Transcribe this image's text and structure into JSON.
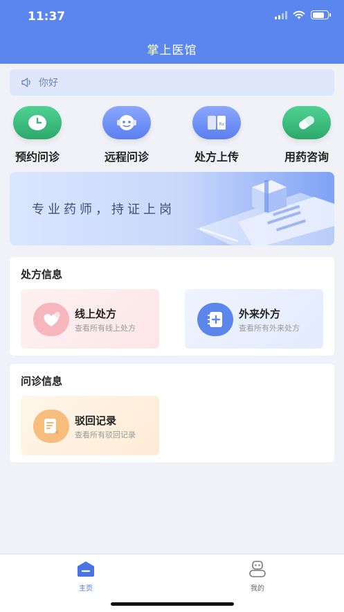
{
  "status_bar": {
    "time": "11:37"
  },
  "header": {
    "title": "掌上医馆"
  },
  "notice": {
    "text": "你好",
    "icon": "speaker-icon"
  },
  "quick_actions": [
    {
      "label": "预约问诊",
      "icon": "clock-icon",
      "color": "#35b57a"
    },
    {
      "label": "远程问诊",
      "icon": "headset-icon",
      "color": "#5b7ef0"
    },
    {
      "label": "处方上传",
      "icon": "book-icon",
      "color": "#5b7ef0"
    },
    {
      "label": "用药咨询",
      "icon": "pill-icon",
      "color": "#35b57a"
    }
  ],
  "banner": {
    "text": "专业药师，持证上岗"
  },
  "prescription_section": {
    "title": "处方信息",
    "tiles": [
      {
        "title": "线上处方",
        "subtitle": "查看所有线上处方",
        "icon": "heart-chat-icon"
      },
      {
        "title": "外来外方",
        "subtitle": "查看所有外来处方",
        "icon": "notebook-plus-icon"
      }
    ]
  },
  "consult_section": {
    "title": "问诊信息",
    "tiles": [
      {
        "title": "驳回记录",
        "subtitle": "查看所有驳回记录",
        "icon": "document-return-icon"
      }
    ]
  },
  "tabbar": {
    "tabs": [
      {
        "label": "主页",
        "icon": "home-icon",
        "active": true
      },
      {
        "label": "我的",
        "icon": "robot-user-icon",
        "active": false
      }
    ]
  },
  "colors": {
    "primary": "#5a86ee",
    "active_tab": "#4a74e6",
    "inactive_tab": "#666666"
  }
}
